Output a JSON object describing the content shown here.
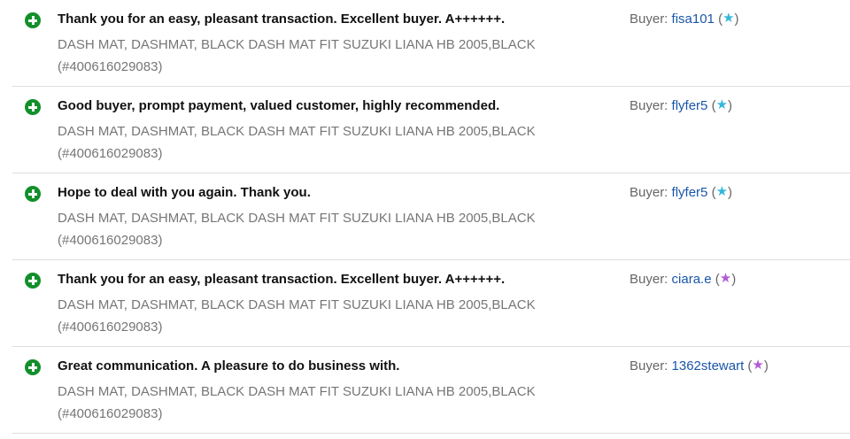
{
  "feedback": [
    {
      "comment": "Thank you for an easy, pleasant transaction. Excellent buyer. A++++++.",
      "item": "DASH MAT, DASHMAT, BLACK DASH MAT FIT SUZUKI LIANA HB 2005,BLACK (#400616029083)",
      "buyer_label": "Buyer: ",
      "buyer_name": "fisa101",
      "star": "★",
      "star_color": "#34b8d8",
      "rating_type": "positive"
    },
    {
      "comment": "Good buyer, prompt payment, valued customer, highly recommended.",
      "item": "DASH MAT, DASHMAT, BLACK DASH MAT FIT SUZUKI LIANA HB 2005,BLACK (#400616029083)",
      "buyer_label": "Buyer: ",
      "buyer_name": "flyfer5",
      "star": "★",
      "star_color": "#34b8d8",
      "rating_type": "positive"
    },
    {
      "comment": "Hope to deal with you again. Thank you.",
      "item": "DASH MAT, DASHMAT, BLACK DASH MAT FIT SUZUKI LIANA HB 2005,BLACK (#400616029083)",
      "buyer_label": "Buyer: ",
      "buyer_name": "flyfer5",
      "star": "★",
      "star_color": "#34b8d8",
      "rating_type": "positive"
    },
    {
      "comment": "Thank you for an easy, pleasant transaction. Excellent buyer. A++++++.",
      "item": "DASH MAT, DASHMAT, BLACK DASH MAT FIT SUZUKI LIANA HB 2005,BLACK (#400616029083)",
      "buyer_label": "Buyer: ",
      "buyer_name": "ciara.e",
      "star": "★",
      "star_color": "#b25ad6",
      "rating_type": "positive"
    },
    {
      "comment": "Great communication. A pleasure to do business with.",
      "item": "DASH MAT, DASHMAT, BLACK DASH MAT FIT SUZUKI LIANA HB 2005,BLACK (#400616029083)",
      "buyer_label": "Buyer: ",
      "buyer_name": "1362stewart",
      "star": "★",
      "star_color": "#b25ad6",
      "rating_type": "positive"
    }
  ],
  "icons": {
    "positive": "positive-feedback-plus-icon",
    "star": "feedback-star-icon"
  },
  "colors": {
    "positive_green": "#128f2a",
    "link_blue": "#1a56a8",
    "muted_text": "#767676"
  }
}
